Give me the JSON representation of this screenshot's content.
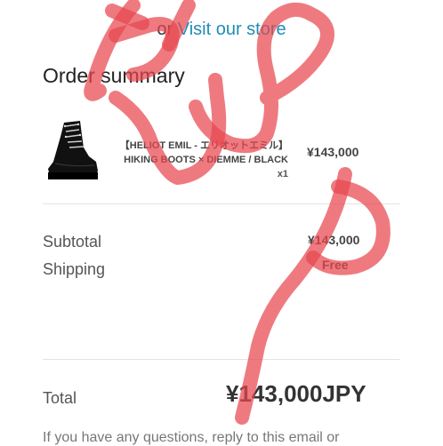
{
  "header": {
    "prefix": "or",
    "store_link": "Visit our store"
  },
  "order_summary": {
    "title": "Order summary",
    "item": {
      "name": "【HELIOT EMIL - エリオットエミル】 HIKING BOOTS × DIEMME / BLACK",
      "quantity": "x1",
      "price": "¥143,000",
      "image_icon": "hiking-boot-image"
    }
  },
  "totals": {
    "subtotal_label": "Subtotal",
    "subtotal_value": "¥143,000",
    "shipping_label": "Shipping",
    "shipping_value": "Free",
    "total_label": "Total",
    "total_value": "¥143,000JPY"
  },
  "footer": {
    "text": "If you have any questions, reply to this email or"
  },
  "colors": {
    "link": "#1f8db5",
    "scribble": "#e8474f"
  }
}
